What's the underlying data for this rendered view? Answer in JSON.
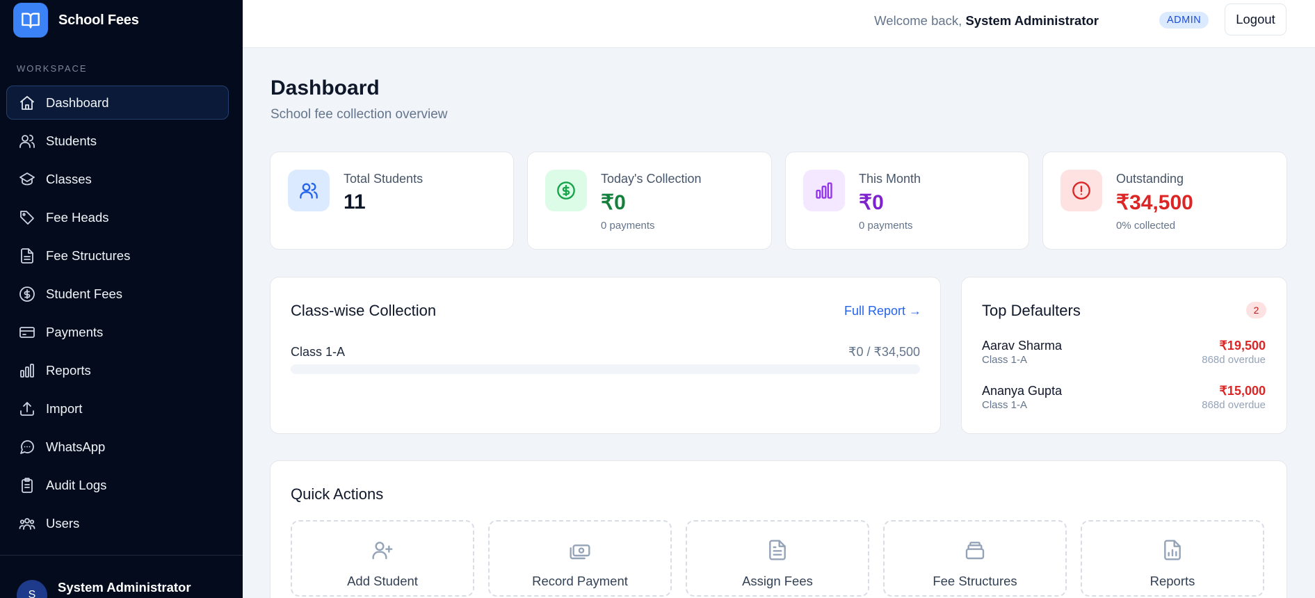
{
  "app": {
    "name": "School Fees"
  },
  "sidebar": {
    "section_label": "WORKSPACE",
    "items": [
      {
        "label": "Dashboard",
        "icon": "home-icon",
        "active": true
      },
      {
        "label": "Students",
        "icon": "users-icon"
      },
      {
        "label": "Classes",
        "icon": "layers-icon"
      },
      {
        "label": "Fee Heads",
        "icon": "tag-icon"
      },
      {
        "label": "Fee Structures",
        "icon": "file-icon"
      },
      {
        "label": "Student Fees",
        "icon": "dollar-circle-icon"
      },
      {
        "label": "Payments",
        "icon": "credit-card-icon"
      },
      {
        "label": "Reports",
        "icon": "bar-chart-icon"
      },
      {
        "label": "Import",
        "icon": "upload-icon"
      },
      {
        "label": "WhatsApp",
        "icon": "message-icon"
      },
      {
        "label": "Audit Logs",
        "icon": "clipboard-icon"
      },
      {
        "label": "Users",
        "icon": "users-group-icon"
      }
    ],
    "user": {
      "initial": "S",
      "name": "System Administrator"
    }
  },
  "header": {
    "welcome_prefix": "Welcome back,",
    "user_name": "System Administrator",
    "role": "ADMIN",
    "logout_label": "Logout"
  },
  "page": {
    "title": "Dashboard",
    "subtitle": "School fee collection overview"
  },
  "stats": [
    {
      "label": "Total Students",
      "value": "11",
      "note": "",
      "icon": "users-icon",
      "color": "#2563eb",
      "bg": "#dbeafe",
      "value_color": "#0f172a"
    },
    {
      "label": "Today's Collection",
      "value": "₹0",
      "note": "0 payments",
      "icon": "dollar-circle-icon",
      "color": "#16a34a",
      "bg": "#dcfce7",
      "value_color": "#15803d"
    },
    {
      "label": "This Month",
      "value": "₹0",
      "note": "0 payments",
      "icon": "bar-chart-icon",
      "color": "#9333ea",
      "bg": "#f3e8ff",
      "value_color": "#7e22ce"
    },
    {
      "label": "Outstanding",
      "value": "₹34,500",
      "note": "0% collected",
      "icon": "alert-circle-icon",
      "color": "#dc2626",
      "bg": "#fee2e2",
      "value_color": "#dc2626"
    }
  ],
  "class_collection": {
    "title": "Class-wise Collection",
    "link_label": "Full Report →",
    "classes": [
      {
        "name": "Class 1-A",
        "amount": "₹0 / ₹34,500",
        "progress": 0
      }
    ]
  },
  "defaulters": {
    "title": "Top Defaulters",
    "count": "2",
    "items": [
      {
        "name": "Aarav Sharma",
        "class": "Class 1-A",
        "amount": "₹19,500",
        "overdue": "868d overdue"
      },
      {
        "name": "Ananya Gupta",
        "class": "Class 1-A",
        "amount": "₹15,000",
        "overdue": "868d overdue"
      }
    ]
  },
  "quick_actions": {
    "title": "Quick Actions",
    "items": [
      {
        "label": "Add Student",
        "icon": "user-plus-icon"
      },
      {
        "label": "Record Payment",
        "icon": "cash-icon"
      },
      {
        "label": "Assign Fees",
        "icon": "file-text-icon"
      },
      {
        "label": "Fee Structures",
        "icon": "stack-icon"
      },
      {
        "label": "Reports",
        "icon": "file-chart-icon"
      }
    ]
  }
}
